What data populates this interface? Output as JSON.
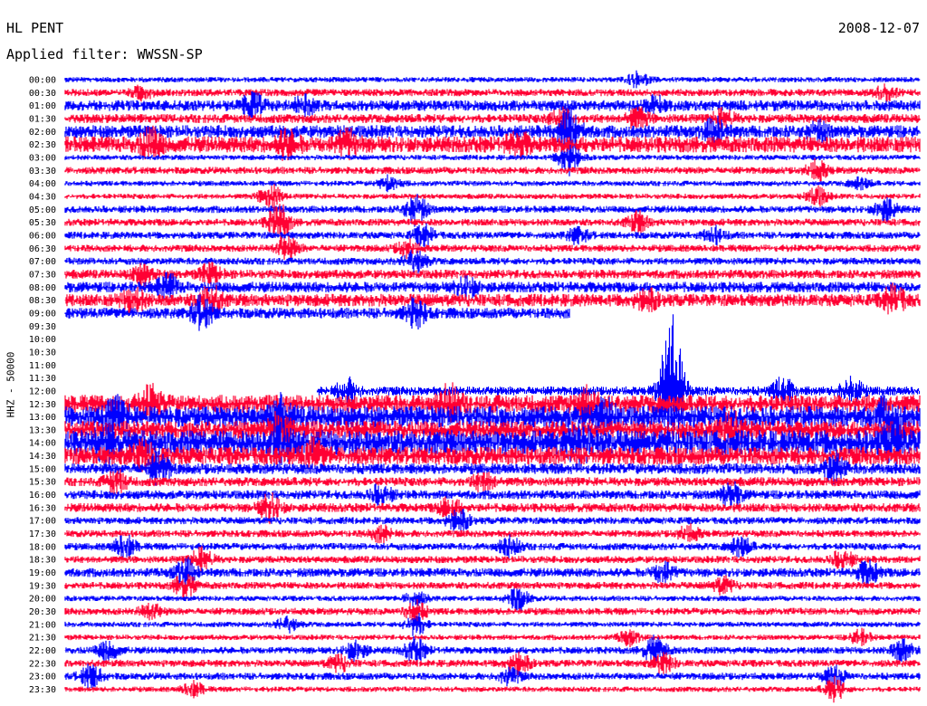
{
  "header": {
    "station": "HL PENT",
    "date": "2008-12-07",
    "filter": "Applied filter: WWSSN-SP"
  },
  "chart_data": {
    "type": "line",
    "title": "HL PENT",
    "date": "2008-12-07",
    "filter": "WWSSN-SP",
    "ylabel": "HHZ - 50000",
    "colors": [
      "#0000ff",
      "#ff0033"
    ],
    "rows": [
      {
        "label": "00:00",
        "segments": [
          [
            0,
            1
          ]
        ],
        "amp": 3,
        "events": [
          [
            0.67,
            8
          ]
        ]
      },
      {
        "label": "00:30",
        "segments": [
          [
            0,
            1
          ]
        ],
        "amp": 4,
        "events": [
          [
            0.09,
            6
          ],
          [
            0.96,
            7
          ]
        ]
      },
      {
        "label": "01:00",
        "segments": [
          [
            0,
            1
          ]
        ],
        "amp": 6,
        "events": [
          [
            0.22,
            12
          ],
          [
            0.28,
            10
          ],
          [
            0.69,
            8
          ]
        ]
      },
      {
        "label": "01:30",
        "segments": [
          [
            0,
            1
          ]
        ],
        "amp": 5,
        "events": [
          [
            0.58,
            10
          ],
          [
            0.67,
            10
          ],
          [
            0.77,
            9
          ]
        ]
      },
      {
        "label": "02:00",
        "segments": [
          [
            0,
            1
          ]
        ],
        "amp": 7,
        "events": [
          [
            0.59,
            24
          ],
          [
            0.76,
            12
          ],
          [
            0.88,
            8
          ]
        ]
      },
      {
        "label": "02:30",
        "segments": [
          [
            0,
            1
          ]
        ],
        "amp": 9,
        "events": [
          [
            0.1,
            14
          ],
          [
            0.26,
            12
          ],
          [
            0.33,
            12
          ],
          [
            0.53,
            10
          ]
        ]
      },
      {
        "label": "03:00",
        "segments": [
          [
            0,
            1
          ]
        ],
        "amp": 3,
        "events": [
          [
            0.59,
            18
          ]
        ]
      },
      {
        "label": "03:30",
        "segments": [
          [
            0,
            1
          ]
        ],
        "amp": 4,
        "events": [
          [
            0.88,
            10
          ]
        ]
      },
      {
        "label": "04:00",
        "segments": [
          [
            0,
            1
          ]
        ],
        "amp": 3,
        "events": [
          [
            0.38,
            8
          ],
          [
            0.93,
            6
          ]
        ]
      },
      {
        "label": "04:30",
        "segments": [
          [
            0,
            1
          ]
        ],
        "amp": 3,
        "events": [
          [
            0.24,
            14
          ],
          [
            0.88,
            10
          ]
        ]
      },
      {
        "label": "05:00",
        "segments": [
          [
            0,
            1
          ]
        ],
        "amp": 4,
        "events": [
          [
            0.41,
            16
          ],
          [
            0.96,
            12
          ]
        ]
      },
      {
        "label": "05:30",
        "segments": [
          [
            0,
            1
          ]
        ],
        "amp": 4,
        "events": [
          [
            0.25,
            20
          ],
          [
            0.67,
            10
          ]
        ]
      },
      {
        "label": "06:00",
        "segments": [
          [
            0,
            1
          ]
        ],
        "amp": 4,
        "events": [
          [
            0.42,
            10
          ],
          [
            0.6,
            8
          ],
          [
            0.76,
            8
          ]
        ]
      },
      {
        "label": "06:30",
        "segments": [
          [
            0,
            1
          ]
        ],
        "amp": 4,
        "events": [
          [
            0.26,
            12
          ],
          [
            0.4,
            8
          ]
        ]
      },
      {
        "label": "07:00",
        "segments": [
          [
            0,
            1
          ]
        ],
        "amp": 4,
        "events": [
          [
            0.41,
            12
          ]
        ]
      },
      {
        "label": "07:30",
        "segments": [
          [
            0,
            1
          ]
        ],
        "amp": 5,
        "events": [
          [
            0.09,
            10
          ],
          [
            0.17,
            10
          ]
        ]
      },
      {
        "label": "08:00",
        "segments": [
          [
            0,
            1
          ]
        ],
        "amp": 6,
        "events": [
          [
            0.12,
            12
          ],
          [
            0.47,
            10
          ]
        ]
      },
      {
        "label": "08:30",
        "segments": [
          [
            0,
            1
          ]
        ],
        "amp": 7,
        "events": [
          [
            0.08,
            12
          ],
          [
            0.17,
            14
          ],
          [
            0.68,
            10
          ],
          [
            0.97,
            14
          ]
        ]
      },
      {
        "label": "09:00",
        "segments": [
          [
            0,
            0.591
          ]
        ],
        "amp": 6,
        "events": [
          [
            0.16,
            16
          ],
          [
            0.41,
            14
          ]
        ]
      },
      {
        "label": "09:30",
        "segments": [],
        "amp": 0,
        "events": []
      },
      {
        "label": "10:00",
        "segments": [],
        "amp": 0,
        "events": []
      },
      {
        "label": "10:30",
        "segments": [],
        "amp": 0,
        "events": []
      },
      {
        "label": "11:00",
        "segments": [],
        "amp": 0,
        "events": []
      },
      {
        "label": "11:30",
        "segments": [],
        "amp": 0,
        "events": []
      },
      {
        "label": "12:00",
        "segments": [
          [
            0.295,
            1
          ]
        ],
        "amp": 5,
        "events": [
          [
            0.33,
            12
          ],
          [
            0.71,
            90
          ],
          [
            0.84,
            14
          ],
          [
            0.92,
            14
          ]
        ]
      },
      {
        "label": "12:30",
        "segments": [
          [
            0,
            1
          ]
        ],
        "amp": 10,
        "events": [
          [
            0.1,
            14
          ],
          [
            0.45,
            16
          ],
          [
            0.61,
            14
          ]
        ]
      },
      {
        "label": "13:00",
        "segments": [
          [
            0,
            1
          ]
        ],
        "amp": 12,
        "events": [
          [
            0.06,
            14
          ],
          [
            0.25,
            16
          ],
          [
            0.63,
            14
          ],
          [
            0.96,
            16
          ]
        ]
      },
      {
        "label": "13:30",
        "segments": [
          [
            0,
            1
          ]
        ],
        "amp": 10,
        "events": [
          [
            0.25,
            14
          ],
          [
            0.78,
            14
          ]
        ]
      },
      {
        "label": "14:00",
        "segments": [
          [
            0,
            1
          ]
        ],
        "amp": 14,
        "events": [
          [
            0.05,
            16
          ],
          [
            0.25,
            18
          ],
          [
            0.6,
            18
          ],
          [
            0.97,
            16
          ]
        ]
      },
      {
        "label": "14:30",
        "segments": [
          [
            0,
            1
          ]
        ],
        "amp": 10,
        "events": [
          [
            0.09,
            12
          ],
          [
            0.29,
            12
          ]
        ]
      },
      {
        "label": "15:00",
        "segments": [
          [
            0,
            1
          ]
        ],
        "amp": 6,
        "events": [
          [
            0.11,
            16
          ],
          [
            0.9,
            14
          ]
        ]
      },
      {
        "label": "15:30",
        "segments": [
          [
            0,
            1
          ]
        ],
        "amp": 5,
        "events": [
          [
            0.06,
            12
          ],
          [
            0.49,
            10
          ]
        ]
      },
      {
        "label": "16:00",
        "segments": [
          [
            0,
            1
          ]
        ],
        "amp": 5,
        "events": [
          [
            0.37,
            10
          ],
          [
            0.78,
            12
          ]
        ]
      },
      {
        "label": "16:30",
        "segments": [
          [
            0,
            1
          ]
        ],
        "amp": 5,
        "events": [
          [
            0.24,
            14
          ],
          [
            0.45,
            10
          ]
        ]
      },
      {
        "label": "17:00",
        "segments": [
          [
            0,
            1
          ]
        ],
        "amp": 4,
        "events": [
          [
            0.46,
            12
          ]
        ]
      },
      {
        "label": "17:30",
        "segments": [
          [
            0,
            1
          ]
        ],
        "amp": 4,
        "events": [
          [
            0.37,
            8
          ],
          [
            0.73,
            8
          ]
        ]
      },
      {
        "label": "18:00",
        "segments": [
          [
            0,
            1
          ]
        ],
        "amp": 4,
        "events": [
          [
            0.07,
            12
          ],
          [
            0.52,
            10
          ],
          [
            0.79,
            10
          ]
        ]
      },
      {
        "label": "18:30",
        "segments": [
          [
            0,
            1
          ]
        ],
        "amp": 4,
        "events": [
          [
            0.16,
            12
          ],
          [
            0.91,
            10
          ]
        ]
      },
      {
        "label": "19:00",
        "segments": [
          [
            0,
            1
          ]
        ],
        "amp": 5,
        "events": [
          [
            0.14,
            14
          ],
          [
            0.7,
            10
          ],
          [
            0.94,
            12
          ]
        ]
      },
      {
        "label": "19:30",
        "segments": [
          [
            0,
            1
          ]
        ],
        "amp": 4,
        "events": [
          [
            0.14,
            12
          ],
          [
            0.77,
            8
          ]
        ]
      },
      {
        "label": "20:00",
        "segments": [
          [
            0,
            1
          ]
        ],
        "amp": 3,
        "events": [
          [
            0.41,
            8
          ],
          [
            0.53,
            12
          ]
        ]
      },
      {
        "label": "20:30",
        "segments": [
          [
            0,
            1
          ]
        ],
        "amp": 4,
        "events": [
          [
            0.1,
            8
          ],
          [
            0.41,
            10
          ]
        ]
      },
      {
        "label": "21:00",
        "segments": [
          [
            0,
            1
          ]
        ],
        "amp": 3,
        "events": [
          [
            0.26,
            8
          ],
          [
            0.41,
            12
          ]
        ]
      },
      {
        "label": "21:30",
        "segments": [
          [
            0,
            1
          ]
        ],
        "amp": 3,
        "events": [
          [
            0.66,
            8
          ],
          [
            0.93,
            8
          ]
        ]
      },
      {
        "label": "22:00",
        "segments": [
          [
            0,
            1
          ]
        ],
        "amp": 4,
        "events": [
          [
            0.05,
            10
          ],
          [
            0.34,
            10
          ],
          [
            0.41,
            12
          ],
          [
            0.69,
            14
          ],
          [
            0.98,
            12
          ]
        ]
      },
      {
        "label": "22:30",
        "segments": [
          [
            0,
            1
          ]
        ],
        "amp": 4,
        "events": [
          [
            0.32,
            8
          ],
          [
            0.53,
            12
          ],
          [
            0.7,
            10
          ]
        ]
      },
      {
        "label": "23:00",
        "segments": [
          [
            0,
            1
          ]
        ],
        "amp": 4,
        "events": [
          [
            0.03,
            12
          ],
          [
            0.52,
            8
          ],
          [
            0.9,
            10
          ]
        ]
      },
      {
        "label": "23:30",
        "segments": [
          [
            0,
            1
          ]
        ],
        "amp": 3,
        "events": [
          [
            0.15,
            8
          ],
          [
            0.9,
            12
          ]
        ]
      }
    ]
  }
}
